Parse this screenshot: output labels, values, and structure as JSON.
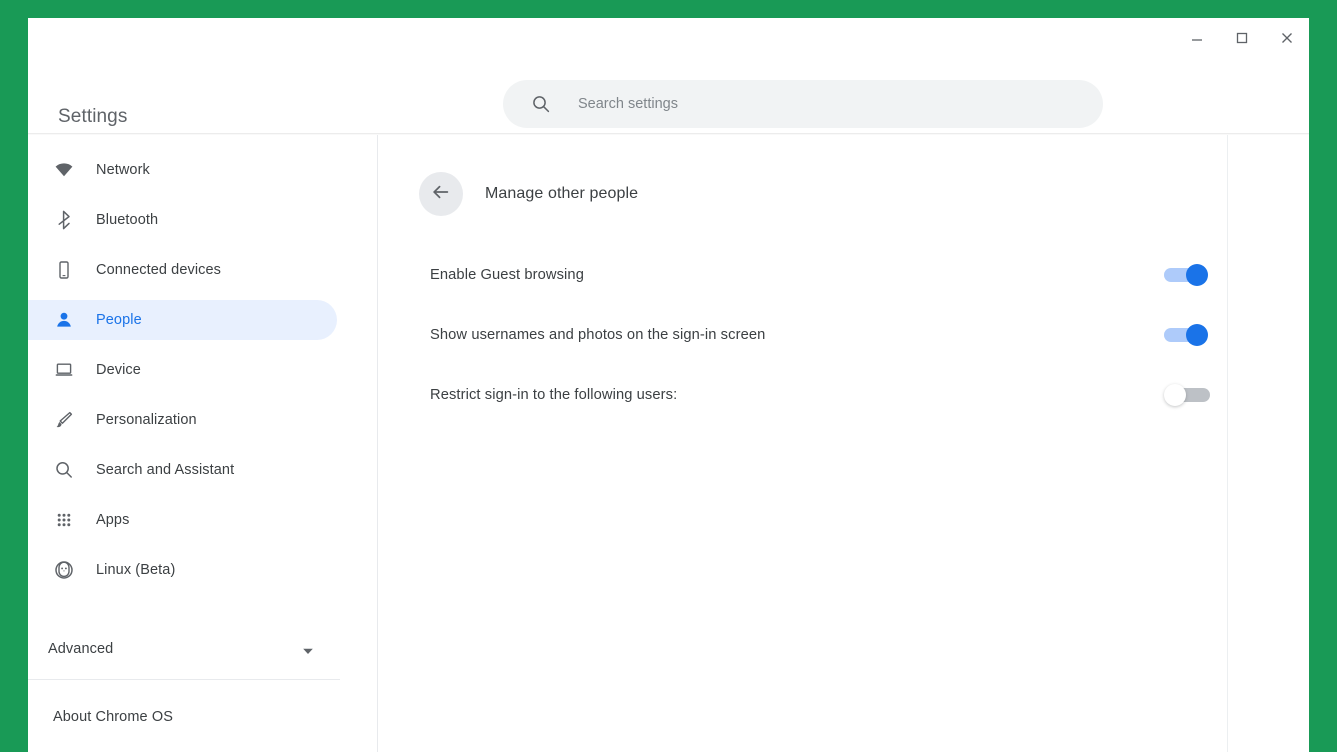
{
  "window": {
    "controls": {
      "minimize": "minimize",
      "maximize": "maximize",
      "close": "close"
    }
  },
  "header": {
    "app_title": "Settings",
    "search": {
      "placeholder": "Search settings",
      "value": ""
    }
  },
  "sidebar": {
    "items": [
      {
        "label": "Network",
        "icon": "wifi-icon",
        "selected": false
      },
      {
        "label": "Bluetooth",
        "icon": "bluetooth-icon",
        "selected": false
      },
      {
        "label": "Connected devices",
        "icon": "phone-icon",
        "selected": false
      },
      {
        "label": "People",
        "icon": "person-icon",
        "selected": true
      },
      {
        "label": "Device",
        "icon": "laptop-icon",
        "selected": false
      },
      {
        "label": "Personalization",
        "icon": "paintbrush-icon",
        "selected": false
      },
      {
        "label": "Search and Assistant",
        "icon": "search-icon",
        "selected": false
      },
      {
        "label": "Apps",
        "icon": "apps-grid-icon",
        "selected": false
      },
      {
        "label": "Linux (Beta)",
        "icon": "linux-penguin-icon",
        "selected": false
      }
    ],
    "advanced": {
      "label": "Advanced",
      "chevron": "chevron-down-icon"
    },
    "about": {
      "label": "About Chrome OS"
    }
  },
  "main": {
    "back_button": "back-arrow-icon",
    "page_title": "Manage other people",
    "settings": [
      {
        "label": "Enable Guest browsing",
        "state": "on"
      },
      {
        "label": "Show usernames and photos on the sign-in screen",
        "state": "on"
      },
      {
        "label": "Restrict sign-in to the following users:",
        "state": "off"
      }
    ]
  },
  "colors": {
    "desktop_background": "#199a56",
    "accent": "#1a73e8",
    "selected_nav_background": "#e8f0fe",
    "toggle_on_track": "#aecbfa",
    "toggle_off_track": "#bdc1c6",
    "text_primary": "#3c4043",
    "search_background": "#f1f3f4"
  }
}
